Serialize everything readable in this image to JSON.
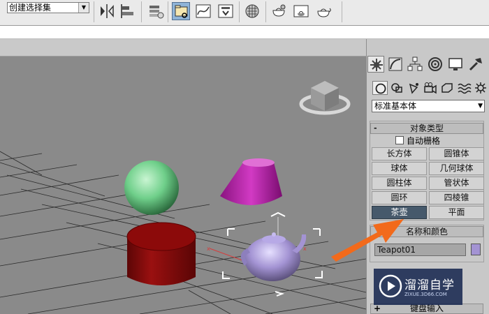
{
  "toolbar": {
    "selection_set": "创建选择集",
    "buttons": [
      "mirror-icon",
      "align-icon",
      "layer-manager-icon",
      "scene-explorer-icon",
      "curve-editor-icon",
      "schematic-view-icon",
      "material-editor-icon",
      "render-setup-icon",
      "rendered-frame-icon",
      "render-production-icon"
    ]
  },
  "panel": {
    "tabs": [
      "create-icon",
      "modify-icon",
      "hierarchy-icon",
      "motion-icon",
      "display-icon",
      "utilities-icon"
    ],
    "subtabs": [
      "geometry-icon",
      "shapes-icon",
      "lights-icon",
      "cameras-icon",
      "helpers-icon",
      "space-warps-icon",
      "systems-icon"
    ],
    "category": "标准基本体",
    "object_type": {
      "title": "对象类型",
      "collapse": "-",
      "autogrid": "自动栅格",
      "buttons": [
        "长方体",
        "圆锥体",
        "球体",
        "几何球体",
        "圆柱体",
        "管状体",
        "圆环",
        "四棱锥",
        "茶壶",
        "平面"
      ],
      "selected": "茶壶"
    },
    "name_color": {
      "title": "名称和颜色",
      "name": "Teapot01",
      "color": "#a393d3"
    },
    "keyboard_entry": {
      "collapse": "+",
      "title": "键盘输入"
    }
  },
  "watermark": {
    "text": "溜溜自学",
    "url": "ZIXUE.3D66.COM"
  },
  "colors": {
    "sphere": "#6fcf8a",
    "cone": "#c020b0",
    "cylinder": "#8c0a0a",
    "teapot": "#a393d3",
    "arrow": "#f26a1b"
  }
}
